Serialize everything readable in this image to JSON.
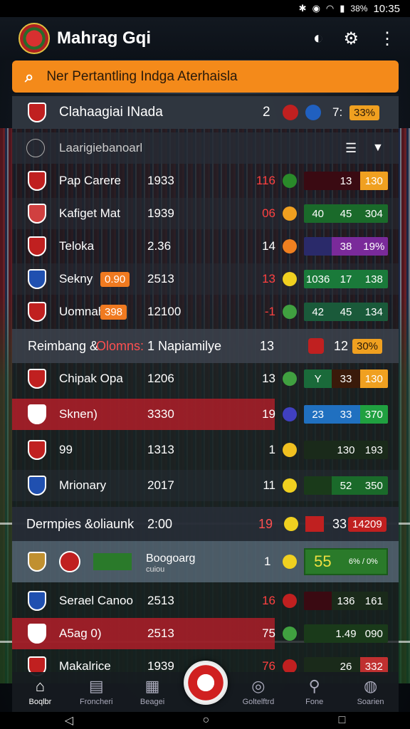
{
  "status_bar": {
    "time": "10:35",
    "battery": "38%"
  },
  "app": {
    "title": "Mahrag Gqi"
  },
  "search": {
    "text": "Ner Pertantling Indga Aterhaisla"
  },
  "header_row": {
    "title": "Clahaagiai INada",
    "num": "2",
    "right_num": "7:",
    "badge": "33%"
  },
  "filter_row": {
    "label": "Laarigiebanoarl"
  },
  "rows": [
    {
      "name": "Pap Carere",
      "year": "1933",
      "num": "116",
      "bar": [
        "",
        "13",
        "130"
      ],
      "colors": [
        "#3a0a12",
        "#3a0a12",
        "#f0a020"
      ],
      "num_color": "#ff4040",
      "dot": "#2a8a2a",
      "crest": "#c02020"
    },
    {
      "name": "Kafiget Mat",
      "year": "1939",
      "num": "06",
      "bar": [
        "40",
        "45",
        "304"
      ],
      "colors": [
        "#1a6a2a",
        "#1a6a2a",
        "#1a6a2a"
      ],
      "num_color": "#ff4040",
      "dot": "#f0a020",
      "crest": "#d04040"
    },
    {
      "name": "Teloka",
      "year": "2.36",
      "num": "14",
      "bar": [
        "",
        "38",
        "19%"
      ],
      "colors": [
        "#2a2a6a",
        "#7a2a9a",
        "#7a2a9a"
      ],
      "num_color": "#ffffff",
      "dot": "#f08020",
      "crest": "#c02020"
    },
    {
      "name": "Sekny",
      "tag": "0.90",
      "year": "2513",
      "num": "13",
      "bar": [
        "1036",
        "17",
        "138"
      ],
      "colors": [
        "#1a7a3a",
        "#1a7a3a",
        "#1a7a3a"
      ],
      "num_color": "#ff4040",
      "dot": "#f0d020",
      "crest": "#2050b0"
    },
    {
      "name": "Uomnah",
      "tag": "398",
      "year": "12100",
      "num": "-1",
      "bar": [
        "42",
        "45",
        "134"
      ],
      "colors": [
        "#1a5a3a",
        "#1a5a3a",
        "#1a5a3a"
      ],
      "num_color": "#ff4040",
      "dot": "#40a040",
      "crest": "#c02020"
    }
  ],
  "section1": {
    "left": "Reimbang &",
    "left_red": "Olomns:",
    "mid": "1 Napiamilye",
    "num": "13",
    "right_num": "12",
    "badge": "30%"
  },
  "rows2": [
    {
      "name": "Chipak Opa",
      "year": "1206",
      "num": "13",
      "bar": [
        "Y",
        "33",
        "130"
      ],
      "colors": [
        "#1a6a3a",
        "#3a1a0a",
        "#f0a020"
      ],
      "num_color": "#ffffff",
      "dot": "#40a040",
      "crest": "#c02020"
    },
    {
      "name": "Sknen)",
      "year": "3330",
      "num": "19",
      "bar": [
        "23",
        "33",
        "370"
      ],
      "colors": [
        "#2070c0",
        "#2070c0",
        "#20a040"
      ],
      "num_color": "#ffffff",
      "dot": "#4040c0",
      "crest": "#ffffff"
    },
    {
      "name": "99",
      "year": "1313",
      "num": "1",
      "bar": [
        "",
        "130",
        "193"
      ],
      "colors": [
        "#1a2a1a",
        "#1a2a1a",
        "#1a2a1a"
      ],
      "num_color": "#ffffff",
      "dot": "#f0c020",
      "crest": "#c02020"
    },
    {
      "name": "Mrionary",
      "year": "2017",
      "num": "11",
      "bar": [
        "",
        "52",
        "350"
      ],
      "colors": [
        "#1a3a1a",
        "#1a6a2a",
        "#1a6a2a"
      ],
      "num_color": "#ffffff",
      "dot": "#f0d020",
      "crest": "#2050b0"
    }
  ],
  "section2": {
    "left": "Dermpies &oliaunk",
    "mid": "2:00",
    "num": "19",
    "right_num": "33",
    "badge": "14209"
  },
  "feature_row": {
    "name": "Boogoarg",
    "sub": "cuiou",
    "num": "1",
    "score": "55",
    "score_right": "6% / 0%"
  },
  "rows3": [
    {
      "name": "Serael Canoo",
      "year": "2513",
      "num": "16",
      "bar": [
        "",
        "136",
        "161"
      ],
      "colors": [
        "#3a0a12",
        "#1a2a1a",
        "#1a2a1a"
      ],
      "num_color": "#ff4040",
      "dot": "#c02020",
      "crest": "#2050b0"
    },
    {
      "name": "A5ag 0)",
      "year": "2513",
      "num": "75",
      "bar": [
        "",
        "1.49",
        "090"
      ],
      "colors": [
        "#1a3a1a",
        "#1a3a1a",
        "#1a3a1a"
      ],
      "num_color": "#ffffff",
      "dot": "#40a040",
      "crest": "#ffffff"
    },
    {
      "name": "Makalrice",
      "year": "1939",
      "num": "76",
      "bar": [
        "",
        "26",
        "332"
      ],
      "colors": [
        "#1a2a1a",
        "#1a2a1a",
        "#c03030"
      ],
      "num_color": "#ff4040",
      "dot": "#c02020",
      "crest": "#c02020"
    }
  ],
  "nav": [
    {
      "label": "Boqlbr",
      "icon": "home-icon"
    },
    {
      "label": "Froncheri",
      "icon": "chart-icon"
    },
    {
      "label": "Beagei",
      "icon": "calendar-icon"
    },
    {
      "label": "Goltelftrd",
      "icon": "search-icon"
    },
    {
      "label": "Fone",
      "icon": "location-icon"
    },
    {
      "label": "Soarien",
      "icon": "ball-icon"
    }
  ]
}
